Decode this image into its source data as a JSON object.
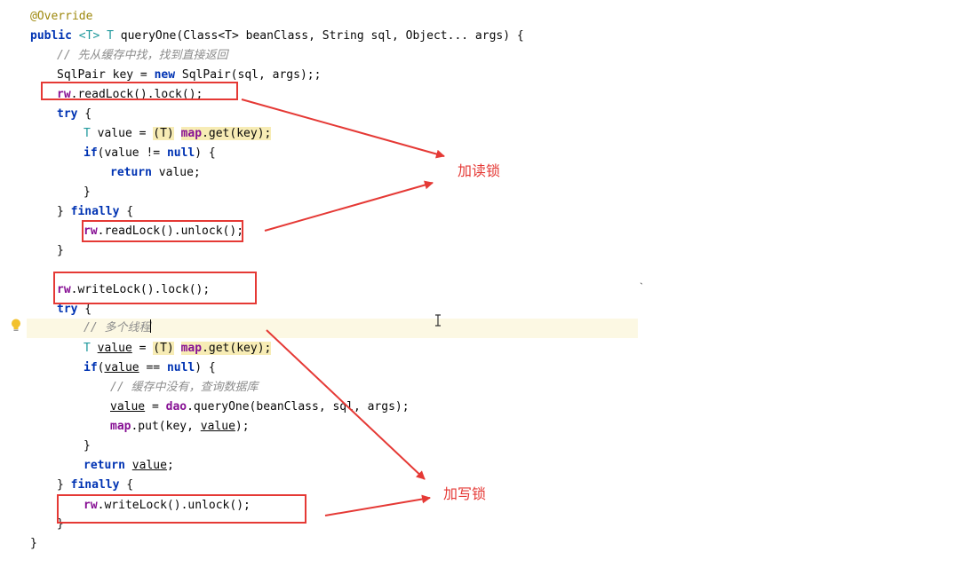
{
  "code": {
    "annotation": "@Override",
    "kw_public": "public",
    "generic": "<T>",
    "type_T": "T",
    "sig_rest": "queryOne(Class<T> beanClass, String sql, Object... args) {",
    "comment_cache_first": "// 先从缓存中找，找到直接返回",
    "sqlpair_decl": "SqlPair key = ",
    "kw_new": "new",
    "sqlpair_ctor": "SqlPair(sql, args);;",
    "rw": "rw",
    "read_lock_call": ".readLock().lock();",
    "kw_try": "try",
    "brace_open": " {",
    "value_decl_eq": " value = ",
    "cast_text": "(T)",
    "map": "map",
    "get_key": ".get(key);",
    "kw_if": "if",
    "if_not_null_open": "(value != ",
    "kw_null": "null",
    "if_close": ") {",
    "kw_return": "return",
    "return_value": " value;",
    "brace_close": "}",
    "finally_open": "} ",
    "kw_finally": "finally",
    "read_unlock_call": ".readLock().unlock();",
    "write_lock_call": ".writeLock().lock();",
    "comment_multi_thread": "// 多个线程",
    "value_word": "value",
    "if_paren": "(",
    "eq_null": " == ",
    "comment_no_cache": "// 缓存中没有，查询数据库",
    "assign_eq": " = ",
    "dao": "dao",
    "dao_call_a": ".queryOne(beanClass, sql, args);",
    "map_put_a": ".put(key, ",
    "map_put_b": ");",
    "semicolon": ";",
    "write_unlock_call": ".writeLock().unlock();"
  },
  "annotations": {
    "read_lock_label": "加读锁",
    "write_lock_label": "加写锁",
    "color": "#e53935"
  },
  "icons": {
    "gutter": "lightbulb-icon",
    "cursor": "text-cursor-icon"
  }
}
